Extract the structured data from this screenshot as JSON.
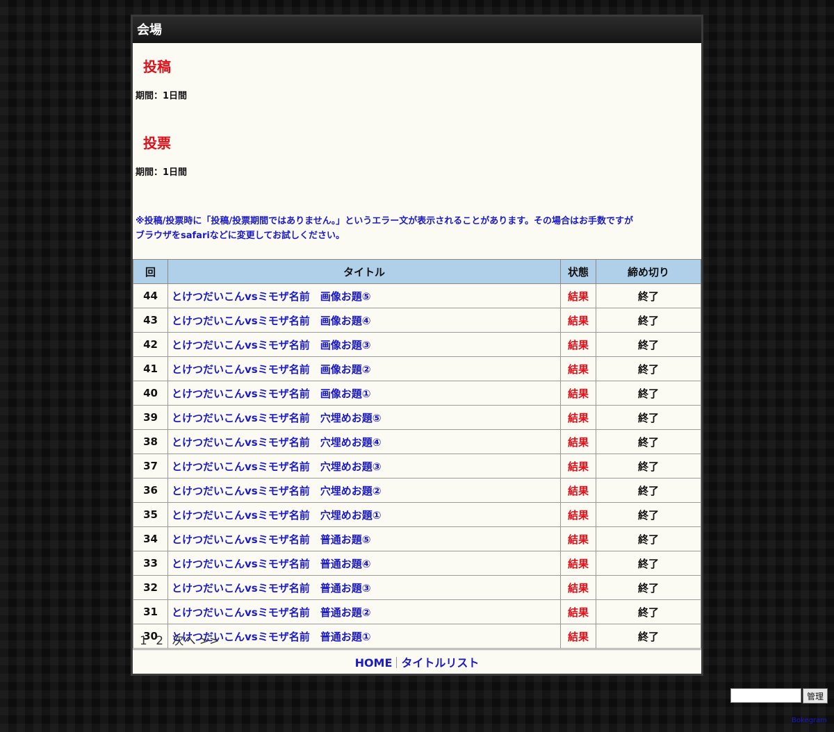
{
  "header": {
    "title": "会場"
  },
  "sections": [
    {
      "title": "投稿",
      "period": "期間：1日間"
    },
    {
      "title": "投票",
      "period": "期間：1日間"
    }
  ],
  "notice": {
    "line1": "※投稿/投票時に「投稿/投票期間ではありません。」というエラー文が表示されることがあります。その場合はお手数ですが",
    "line2": "ブラウザをsafariなどに変更してお試しください。"
  },
  "table": {
    "headers": [
      "回",
      "タイトル",
      "状態",
      "締め切り"
    ],
    "rows": [
      {
        "num": "44",
        "title": "とけつだいこんvsミモザ名前　画像お題⑤",
        "status": "結果",
        "deadline": "終了"
      },
      {
        "num": "43",
        "title": "とけつだいこんvsミモザ名前　画像お題④",
        "status": "結果",
        "deadline": "終了"
      },
      {
        "num": "42",
        "title": "とけつだいこんvsミモザ名前　画像お題③",
        "status": "結果",
        "deadline": "終了"
      },
      {
        "num": "41",
        "title": "とけつだいこんvsミモザ名前　画像お題②",
        "status": "結果",
        "deadline": "終了"
      },
      {
        "num": "40",
        "title": "とけつだいこんvsミモザ名前　画像お題①",
        "status": "結果",
        "deadline": "終了"
      },
      {
        "num": "39",
        "title": "とけつだいこんvsミモザ名前　穴埋めお題⑤",
        "status": "結果",
        "deadline": "終了"
      },
      {
        "num": "38",
        "title": "とけつだいこんvsミモザ名前　穴埋めお題④",
        "status": "結果",
        "deadline": "終了"
      },
      {
        "num": "37",
        "title": "とけつだいこんvsミモザ名前　穴埋めお題③",
        "status": "結果",
        "deadline": "終了"
      },
      {
        "num": "36",
        "title": "とけつだいこんvsミモザ名前　穴埋めお題②",
        "status": "結果",
        "deadline": "終了"
      },
      {
        "num": "35",
        "title": "とけつだいこんvsミモザ名前　穴埋めお題①",
        "status": "結果",
        "deadline": "終了"
      },
      {
        "num": "34",
        "title": "とけつだいこんvsミモザ名前　普通お題⑤",
        "status": "結果",
        "deadline": "終了"
      },
      {
        "num": "33",
        "title": "とけつだいこんvsミモザ名前　普通お題④",
        "status": "結果",
        "deadline": "終了"
      },
      {
        "num": "32",
        "title": "とけつだいこんvsミモザ名前　普通お題③",
        "status": "結果",
        "deadline": "終了"
      },
      {
        "num": "31",
        "title": "とけつだいこんvsミモザ名前　普通お題②",
        "status": "結果",
        "deadline": "終了"
      },
      {
        "num": "30",
        "title": "とけつだいこんvsミモザ名前　普通お題①",
        "status": "結果",
        "deadline": "終了"
      }
    ]
  },
  "pagination": {
    "pages": [
      "1",
      "2"
    ],
    "next": "次へ >>"
  },
  "footer": {
    "home": "HOME",
    "title_list": "タイトルリスト"
  },
  "admin": {
    "button": "管理",
    "input_value": ""
  },
  "credit": "Bokegram",
  "colors": {
    "panel_bg": "#fcfbf3",
    "header_bg": "#1e1e1e",
    "accent_red": "#e0101a",
    "link_blue": "#1a1ac8",
    "table_header_bg": "#b0d0ea"
  }
}
